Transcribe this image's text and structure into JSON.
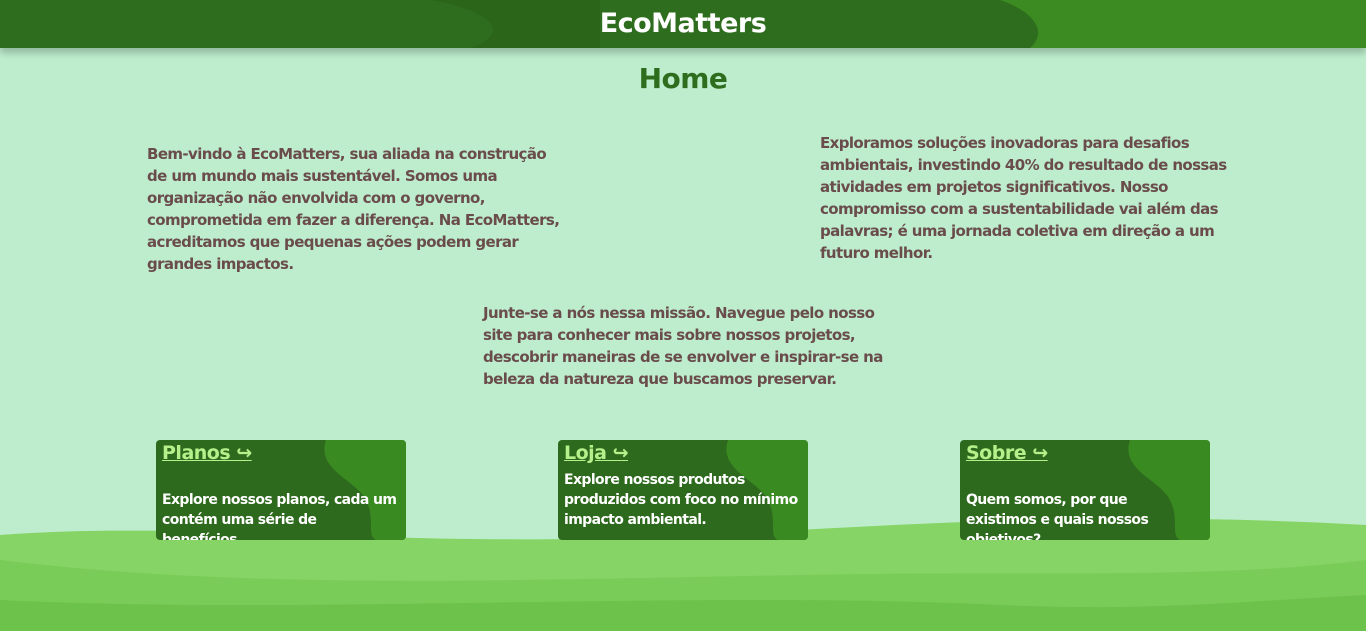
{
  "header": {
    "site_title": "EcoMatters"
  },
  "main": {
    "page_title": "Home",
    "paragraphs": [
      "Bem-vindo à EcoMatters, sua aliada na construção de um mundo mais sustentável. Somos uma organização não envolvida com o governo, comprometida em fazer a diferença. Na EcoMatters, acreditamos que pequenas ações podem gerar grandes impactos.",
      "Exploramos soluções inovadoras para desafios ambientais, investindo 40% do resultado de nossas atividades em projetos significativos. Nosso compromisso com a sustentabilidade vai além das palavras; é uma jornada coletiva em direção a um futuro melhor.",
      "Junte-se a nós nessa missão. Navegue pelo nosso site para conhecer mais sobre nossos projetos, descobrir maneiras de se envolver e inspirar-se na beleza da natureza que buscamos preservar."
    ]
  },
  "cards": [
    {
      "title": "Planos ↪",
      "description": "Explore nossos planos, cada um contém uma série de benefícios."
    },
    {
      "title": "Loja ↪",
      "description": "Explore nossos produtos produzidos com foco no mínimo impacto ambiental."
    },
    {
      "title": "Sobre ↪",
      "description": "Quem somos, por que existimos e quais nossos objetivos?"
    }
  ],
  "colors": {
    "background": "#bdedcc",
    "header": "#2f6d1e",
    "accent_link": "#b6f08b",
    "body_text": "#6a4c4c",
    "wave_light": "#86d465",
    "wave_dark": "#6cc24a"
  }
}
